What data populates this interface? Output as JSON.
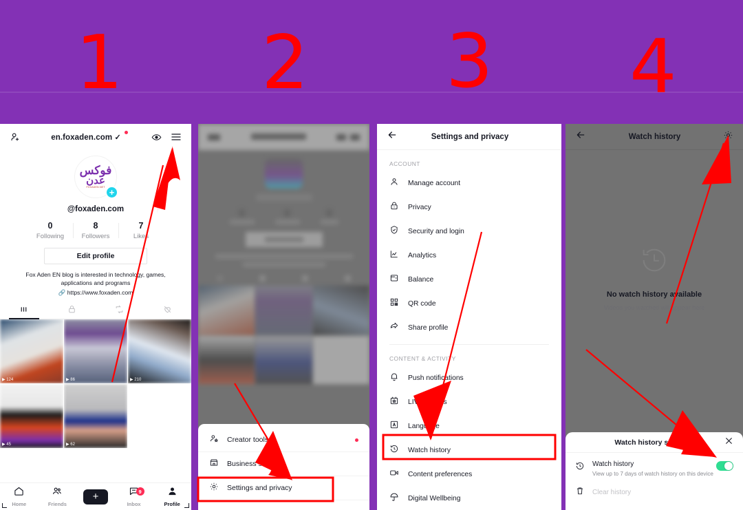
{
  "steps": {
    "labels": [
      "1",
      "2",
      "3",
      "4"
    ]
  },
  "colors": {
    "header_purple": "#8331b5",
    "annotation_red": "#ff0000",
    "accent_pink": "#fe2c55",
    "accent_cyan": "#25f4ee",
    "toggle_green": "#2fdd92"
  },
  "panel1": {
    "header": {
      "title": "en.foxaden.com",
      "verified_check": "✓",
      "add_friend_icon": "person-add-icon",
      "eye_icon": "eye-icon",
      "menu_icon": "hamburger-menu-icon"
    },
    "profile": {
      "avatar_line1": "فوكس",
      "avatar_line2": "عدن",
      "avatar_small": "FOXADEN.NET",
      "plus_badge": "+",
      "handle": "@foxaden.com",
      "stats": [
        {
          "value": "0",
          "label": "Following"
        },
        {
          "value": "8",
          "label": "Followers"
        },
        {
          "value": "7",
          "label": "Likes"
        }
      ],
      "edit_button": "Edit profile",
      "bio": "Fox Aden EN blog is interested in technology, games, applications and programs",
      "bio_link": "https://www.foxaden.com"
    },
    "tabs": [
      {
        "name": "grid-tab",
        "icon": "grid-icon",
        "active": true
      },
      {
        "name": "private-tab",
        "icon": "lock-icon",
        "active": false
      },
      {
        "name": "reposts-tab",
        "icon": "repost-icon",
        "active": false
      },
      {
        "name": "liked-tab",
        "icon": "heart-hidden-icon",
        "active": false
      }
    ],
    "bottom_nav": [
      {
        "label": "Home",
        "icon": "home-icon",
        "active": false
      },
      {
        "label": "Friends",
        "icon": "friends-icon",
        "active": false
      },
      {
        "label": "",
        "icon": "create-plus-icon",
        "active": false
      },
      {
        "label": "Inbox",
        "icon": "inbox-icon",
        "badge": "9",
        "active": false
      },
      {
        "label": "Profile",
        "icon": "profile-icon",
        "active": true
      }
    ]
  },
  "panel2": {
    "menu_items": [
      {
        "label": "Creator tools",
        "icon": "creator-tools-icon",
        "dot": true
      },
      {
        "label": "Business suite",
        "icon": "business-suite-icon",
        "dot": false
      },
      {
        "label": "Settings and privacy",
        "icon": "gear-icon",
        "dot": false,
        "highlighted": true
      }
    ]
  },
  "panel3": {
    "header": {
      "title": "Settings and privacy",
      "back_icon": "back-arrow-icon"
    },
    "sections": [
      {
        "title": "ACCOUNT",
        "items": [
          {
            "label": "Manage account",
            "icon": "person-icon"
          },
          {
            "label": "Privacy",
            "icon": "lock-icon"
          },
          {
            "label": "Security and login",
            "icon": "shield-check-icon"
          },
          {
            "label": "Analytics",
            "icon": "analytics-chart-icon"
          },
          {
            "label": "Balance",
            "icon": "wallet-icon"
          },
          {
            "label": "QR code",
            "icon": "qr-code-icon"
          },
          {
            "label": "Share profile",
            "icon": "share-arrow-icon"
          }
        ]
      },
      {
        "title": "CONTENT & ACTIVITY",
        "items": [
          {
            "label": "Push notifications",
            "icon": "bell-icon"
          },
          {
            "label": "LIVE Events",
            "icon": "calendar-star-icon"
          },
          {
            "label": "Language",
            "icon": "language-a-icon"
          },
          {
            "label": "Watch history",
            "icon": "clock-history-icon",
            "highlighted": true
          },
          {
            "label": "Content preferences",
            "icon": "video-camera-icon"
          },
          {
            "label": "Digital Wellbeing",
            "icon": "umbrella-icon"
          }
        ]
      }
    ]
  },
  "panel4": {
    "header": {
      "title": "Watch history",
      "back_icon": "back-arrow-icon",
      "settings_icon": "gear-icon"
    },
    "empty_state": {
      "icon": "clock-history-icon",
      "title": "No watch history available",
      "subtitle": "Videos you watched will appear here"
    },
    "sheet": {
      "title": "Watch history settings",
      "close_icon": "close-x-icon",
      "toggle_row": {
        "label": "Watch history",
        "sublabel": "View up to 7 days of watch history on this device",
        "icon": "clock-history-icon",
        "toggle_state": "on"
      },
      "clear_row": {
        "label": "Clear history",
        "icon": "trash-icon",
        "disabled": true
      }
    }
  }
}
